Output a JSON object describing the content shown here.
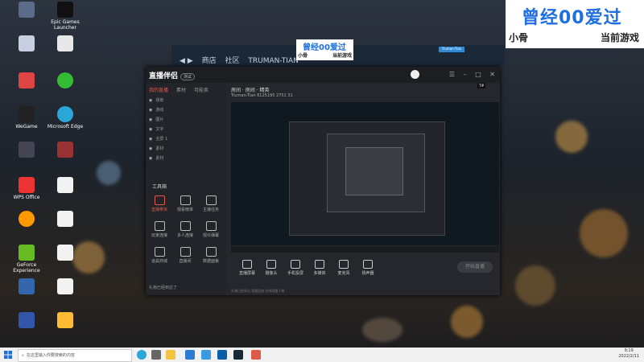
{
  "overlay": {
    "big": "曾经00爱过",
    "left": "小骨",
    "right": "当前游戏"
  },
  "desktop_icons": [
    "",
    "Epic Games Launcher",
    "",
    "",
    "",
    "",
    "WeGame",
    "Microsoft Edge",
    "",
    "",
    "WPS Office",
    "",
    "",
    "",
    "GeForce Experience",
    "",
    "",
    "",
    "",
    ""
  ],
  "steam": {
    "nav": [
      "商店",
      "社区",
      "TRUMAN-TIAN"
    ],
    "user": "Truman-Tian"
  },
  "app": {
    "logo": "直播伴侣",
    "logo_badge": "测试",
    "tabs": [
      "我的直播",
      "素材",
      "可能卖"
    ],
    "scenes": [
      "场景",
      "游戏",
      "图片",
      "文字",
      "全屏 1",
      "素材",
      "素材"
    ],
    "tools_title": "工具箱",
    "tools": [
      {
        "label": "直播带货",
        "red": true
      },
      {
        "label": "观看榜单",
        "red": false
      },
      {
        "label": "主播任务",
        "red": false
      },
      {
        "label": "玩家连接",
        "red": false
      },
      {
        "label": "多人连接",
        "red": false
      },
      {
        "label": "观众弹幕",
        "red": false
      },
      {
        "label": "道具商城",
        "red": false
      },
      {
        "label": "直播间",
        "red": false
      },
      {
        "label": "数据面板",
        "red": false
      }
    ],
    "left_bottom": "礼物已经到达了",
    "room_title": "房间 · 房间 · 精英",
    "room_info": "Truman-Tian  8125195  2751  31",
    "bottom_tools": [
      "直播屏幕",
      "摄像头",
      "手机投屏",
      "多媒体",
      "麦克风",
      "扬声器"
    ],
    "go_live": "开始直播",
    "status": "礼物已经到达  观看回放  在线观看人数",
    "tooltip": "TIP"
  },
  "taskbar": {
    "search_placeholder": "在这里输入你要搜索的内容",
    "time": "9:19",
    "date": "2022/2/11"
  }
}
